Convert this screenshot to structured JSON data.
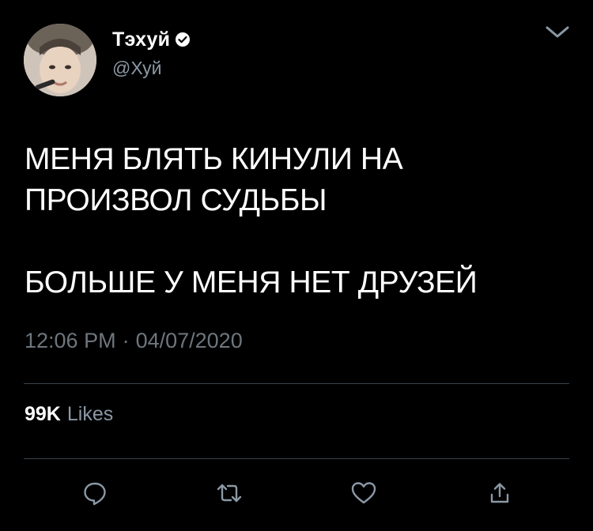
{
  "tweet": {
    "author": {
      "display_name": "Тэхуй",
      "handle": "@Хуй",
      "verified": true
    },
    "text": "МЕНЯ БЛЯТЬ КИНУЛИ НА\nПРОИЗВОЛ СУДЬБЫ\n\nБОЛЬШЕ У МЕНЯ НЕТ ДРУЗЕЙ",
    "time": "12:06 PM",
    "separator": "·",
    "date": "04/07/2020",
    "likes": {
      "count": "99K",
      "label": "Likes"
    }
  },
  "icons": {
    "menu": "chevron-down-icon",
    "reply": "reply-icon",
    "retweet": "retweet-icon",
    "like": "heart-icon",
    "share": "share-icon"
  },
  "colors": {
    "background": "#000000",
    "primary_text": "#ffffff",
    "secondary_text": "#8b98a5",
    "divider": "#38444d",
    "icon": "#8b98a5"
  }
}
